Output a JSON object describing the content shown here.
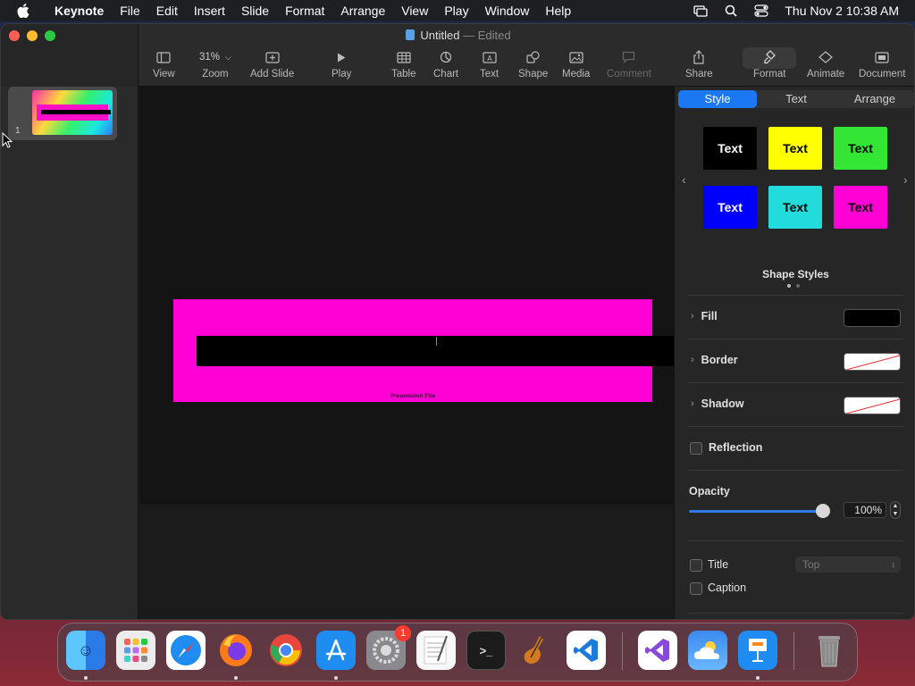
{
  "menubar": {
    "app": "Keynote",
    "items": [
      "File",
      "Edit",
      "Insert",
      "Slide",
      "Format",
      "Arrange",
      "View",
      "Play",
      "Window",
      "Help"
    ],
    "clock": "Thu Nov 2  10:38 AM"
  },
  "window": {
    "doc_name": "Untitled",
    "doc_status": "— Edited"
  },
  "toolbar": {
    "view": "View",
    "zoom_value": "31%",
    "zoom": "Zoom",
    "add_slide": "Add Slide",
    "play": "Play",
    "table": "Table",
    "chart": "Chart",
    "text": "Text",
    "shape": "Shape",
    "media": "Media",
    "comment": "Comment",
    "share": "Share",
    "format": "Format",
    "animate": "Animate",
    "document": "Document"
  },
  "navigator": {
    "slides": [
      {
        "number": "1"
      }
    ]
  },
  "slide": {
    "caption": "Presentation Title"
  },
  "inspector": {
    "tabs": [
      {
        "label": "Style",
        "active": true
      },
      {
        "label": "Text",
        "active": false
      },
      {
        "label": "Arrange",
        "active": false
      }
    ],
    "shape_styles": [
      {
        "label": "Text",
        "bg": "#000000",
        "fg": "#ffffff"
      },
      {
        "label": "Text",
        "bg": "#ffff00",
        "fg": "#000000"
      },
      {
        "label": "Text",
        "bg": "#33e633",
        "fg": "#000000"
      },
      {
        "label": "Text",
        "bg": "#0000ff",
        "fg": "#ffffff"
      },
      {
        "label": "Text",
        "bg": "#22dcdc",
        "fg": "#000000"
      },
      {
        "label": "Text",
        "bg": "#ff00d5",
        "fg": "#000000"
      }
    ],
    "shape_styles_label": "Shape Styles",
    "fill_label": "Fill",
    "border_label": "Border",
    "shadow_label": "Shadow",
    "reflection_label": "Reflection",
    "opacity_label": "Opacity",
    "opacity_value": "100%",
    "opacity_fraction": 1.0,
    "title_label": "Title",
    "title_position": "Top",
    "caption_label": "Caption"
  },
  "dock": {
    "apps": [
      {
        "name": "Finder"
      },
      {
        "name": "Launchpad"
      },
      {
        "name": "Safari"
      },
      {
        "name": "Firefox"
      },
      {
        "name": "Chrome"
      },
      {
        "name": "App Store"
      },
      {
        "name": "System Settings",
        "badge": "1"
      },
      {
        "name": "TextEdit"
      },
      {
        "name": "Terminal"
      },
      {
        "name": "GarageBand"
      },
      {
        "name": "VS Code"
      },
      {
        "name": "Visual Studio"
      },
      {
        "name": "Weather"
      },
      {
        "name": "Keynote"
      },
      {
        "name": "Trash"
      }
    ]
  },
  "colors": {
    "accent": "#1b78f2",
    "slide_magenta": "#ff00d5"
  }
}
